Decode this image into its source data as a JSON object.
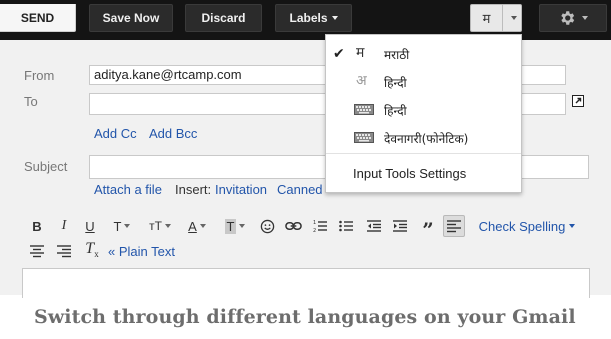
{
  "toolbar": {
    "send_label": "SEND",
    "save_now_label": "Save Now",
    "discard_label": "Discard",
    "labels_label": "Labels",
    "input_tool_char": "म"
  },
  "compose": {
    "from_label": "From",
    "from_value": "aditya.kane@rtcamp.com",
    "to_label": "To",
    "add_cc": "Add Cc",
    "add_bcc": "Add Bcc",
    "subject_label": "Subject",
    "attach_file": "Attach a file",
    "insert_label": "Insert:",
    "insert_invitation": "Invitation",
    "insert_canned": "Canned"
  },
  "formatting": {
    "check_spelling": "Check Spelling",
    "plain_text": "« Plain Text"
  },
  "language_menu": {
    "items": [
      {
        "glyph": "म",
        "label": "मराठी",
        "checked": true,
        "icon": "marathi-script-icon"
      },
      {
        "glyph": "अ",
        "label": "हिन्दी",
        "checked": false,
        "icon": "hindi-script-icon"
      },
      {
        "glyph": "",
        "label": "हिन्दी",
        "checked": false,
        "icon": "keyboard-icon"
      },
      {
        "glyph": "",
        "label": "देवनागरी(फोनेटिक)",
        "checked": false,
        "icon": "keyboard-icon"
      }
    ],
    "settings_label": "Input Tools Settings"
  },
  "caption": "Switch through different languages on your Gmail",
  "colors": {
    "toolbar_bg": "#141414",
    "compose_bg": "#f1f1f1",
    "link": "#2255aa",
    "caption": "#6d6d6d"
  }
}
